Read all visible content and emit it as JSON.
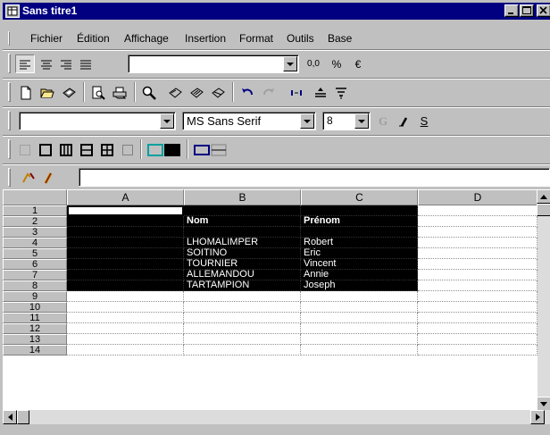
{
  "window": {
    "title": "Sans titre1"
  },
  "menu": [
    "Fichier",
    "Édition",
    "Affichage",
    "Insertion",
    "Format",
    "Outils",
    "Base"
  ],
  "format_toolbar": {
    "number_format_value": "",
    "decimals_label": "0,0",
    "percent_label": "%",
    "currency_label": "€"
  },
  "font_toolbar": {
    "style_value": "",
    "font_value": "MS Sans Serif",
    "size_value": "8",
    "bold_label": "G",
    "italic_label": "I",
    "underline_label": "S"
  },
  "formula_bar": {
    "content": ""
  },
  "sheet": {
    "columns": [
      "A",
      "B",
      "C",
      "D"
    ],
    "rows": [
      "1",
      "2",
      "3",
      "4",
      "5",
      "6",
      "7",
      "8",
      "9",
      "10",
      "11",
      "12",
      "13",
      "14"
    ],
    "cells": {
      "B2": "Nom",
      "C2": "Prénom",
      "B4": "LHOMALIMPER",
      "C4": "Robert",
      "B5": "SOITIÑO",
      "C5": "Eric",
      "B6": "TOURNIER",
      "C6": "Vincent",
      "B7": "ALLEMANDOU",
      "C7": "Annie",
      "B8": "TARTAMPION",
      "C8": "Joseph"
    },
    "selection": "A1:C8",
    "active_cell": "A1"
  },
  "colors": {
    "titlebar": "#000080",
    "chrome": "#c0c0c0",
    "selection": "#000000"
  }
}
